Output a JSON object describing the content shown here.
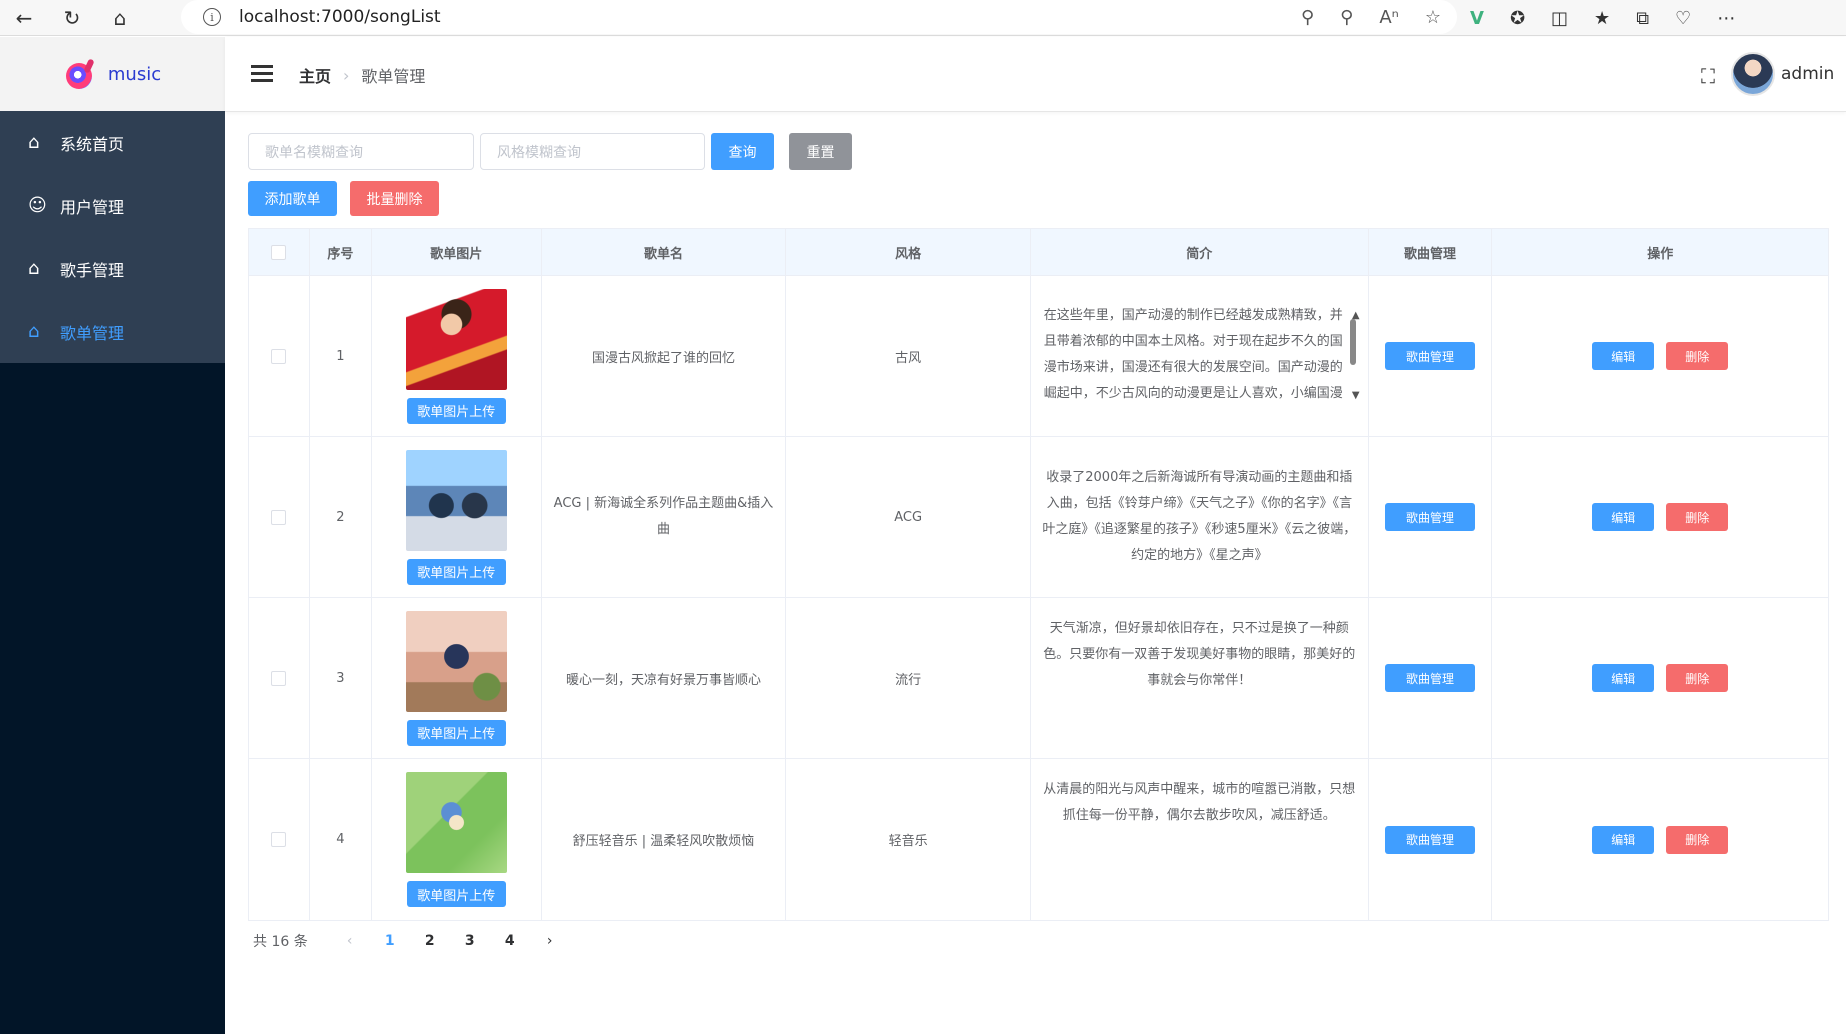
{
  "browser": {
    "url": "localhost:7000/songList"
  },
  "sidebar": {
    "logo_text": "music",
    "items": [
      {
        "label": "系统首页",
        "icon": "home-icon",
        "active": false
      },
      {
        "label": "用户管理",
        "icon": "user-icon",
        "active": false
      },
      {
        "label": "歌手管理",
        "icon": "home-icon",
        "active": false
      },
      {
        "label": "歌单管理",
        "icon": "home-icon",
        "active": true
      }
    ]
  },
  "header": {
    "breadcrumb_home": "主页",
    "breadcrumb_current": "歌单管理",
    "username": "admin"
  },
  "search": {
    "name_placeholder": "歌单名模糊查询",
    "style_placeholder": "风格模糊查询",
    "query_label": "查询",
    "reset_label": "重置"
  },
  "actions": {
    "add_label": "添加歌单",
    "batch_delete_label": "批量删除"
  },
  "table": {
    "headers": [
      "",
      "序号",
      "歌单图片",
      "歌单名",
      "风格",
      "简介",
      "歌曲管理",
      "操作"
    ],
    "upload_label": "歌单图片上传",
    "song_manage_label": "歌曲管理",
    "edit_label": "编辑",
    "delete_label": "删除",
    "rows": [
      {
        "index": "1",
        "name": "国漫古风掀起了谁的回忆",
        "style": "古风",
        "intro": "在这些年里，国产动漫的制作已经越发成熟精致，并且带着浓郁的中国本土风格。对于现在起步不久的国漫市场来讲，国漫还有很大的发展空间。国产动漫的崛起中，不少古风向的动漫更是让人喜欢，小编国漫的歌曲合辑想法的回忆吧。"
      },
      {
        "index": "2",
        "name": "ACG | 新海诚全系列作品主题曲&插入曲",
        "style": "ACG",
        "intro": "收录了2000年之后新海诚所有导演动画的主题曲和插入曲，包括《铃芽户缔》《天气之子》《你的名字》《言叶之庭》《追逐繁星的孩子》《秒速5厘米》《云之彼端，约定的地方》《星之声》"
      },
      {
        "index": "3",
        "name": "暖心一刻，天凉有好景万事皆顺心",
        "style": "流行",
        "intro": "天气渐凉，但好景却依旧存在，只不过是换了一种颜色。只要你有一双善于发现美好事物的眼睛，那美好的事就会与你常伴！"
      },
      {
        "index": "4",
        "name": "舒压轻音乐 | 温柔轻风吹散烦恼",
        "style": "轻音乐",
        "intro": "从清晨的阳光与风声中醒来，城市的喧嚣已消散，只想抓住每一份平静，偶尔去散步吹风，减压舒适。"
      }
    ]
  },
  "pagination": {
    "total_text": "共 16 条",
    "pages": [
      "1",
      "2",
      "3",
      "4"
    ],
    "current": "1"
  },
  "colors": {
    "primary": "#409eff",
    "danger": "#f56c6c",
    "sidebar_bg": "#021528",
    "menu_bg": "#2f3f53"
  }
}
